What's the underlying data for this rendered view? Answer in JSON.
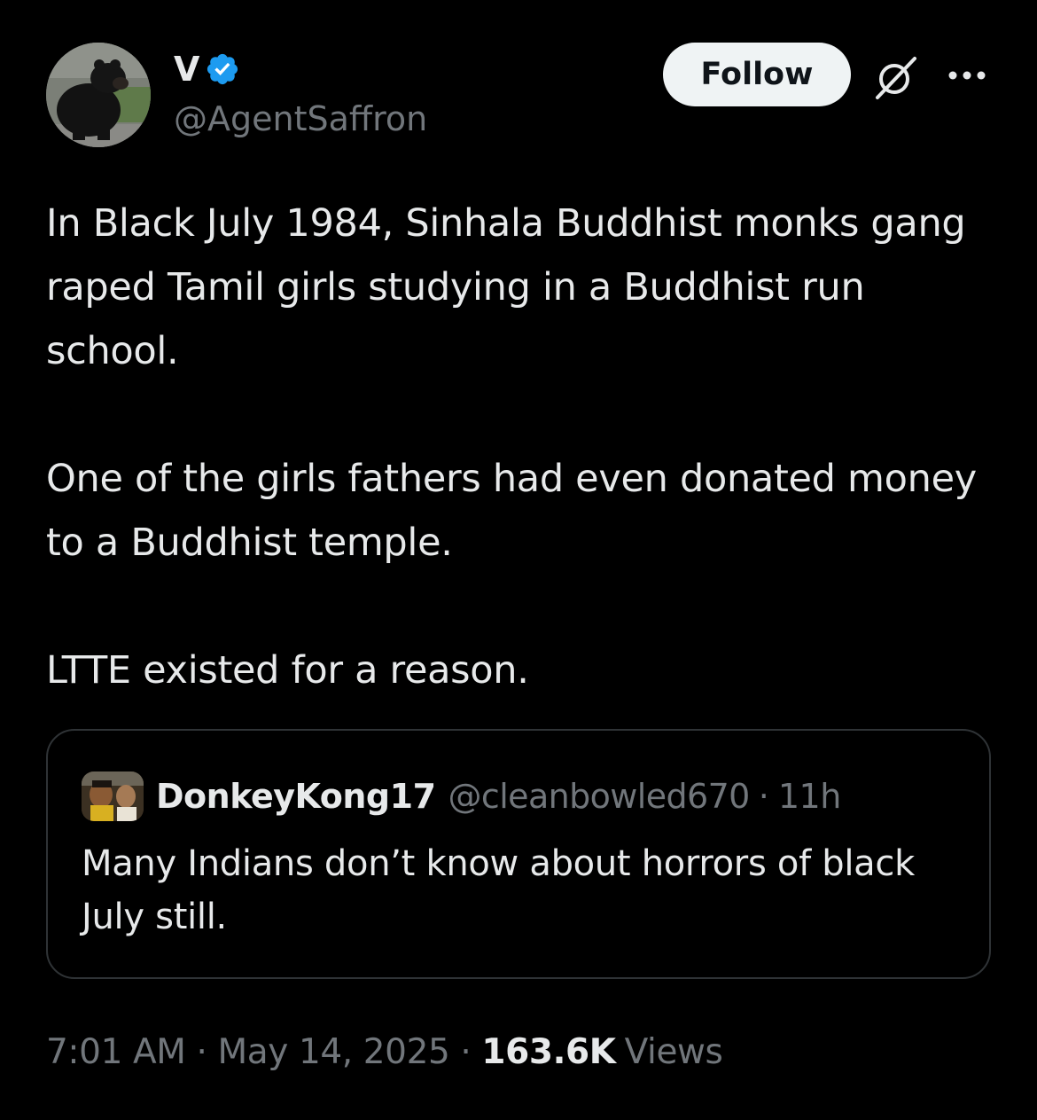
{
  "author": {
    "display_name": "V",
    "handle": "@AgentSaffron",
    "verified": true,
    "avatar": "bear-photo"
  },
  "actions": {
    "follow_label": "Follow",
    "grok_icon": "grok-icon",
    "more_icon": "more-icon"
  },
  "post": {
    "paragraphs": [
      "In Black July 1984, Sinhala Buddhist monks gang raped Tamil girls studying in a Buddhist run school.",
      "One of the girls fathers had even donated money to a Buddhist temple.",
      "LTTE existed for a reason."
    ]
  },
  "quote": {
    "display_name": "DonkeyKong17",
    "handle": "@cleanbowled670",
    "separator": "·",
    "time": "11h",
    "text": "Many Indians don’t know about horrors of black July still."
  },
  "meta": {
    "time": "7:01 AM",
    "separator": "·",
    "date": "May 14, 2025",
    "views_count": "163.6K",
    "views_label": "Views"
  },
  "colors": {
    "background": "#000000",
    "text": "#e7e9ea",
    "muted": "#71767b",
    "border": "#2f3336",
    "verified": "#1d9bf0",
    "follow_bg": "#eff3f4"
  }
}
